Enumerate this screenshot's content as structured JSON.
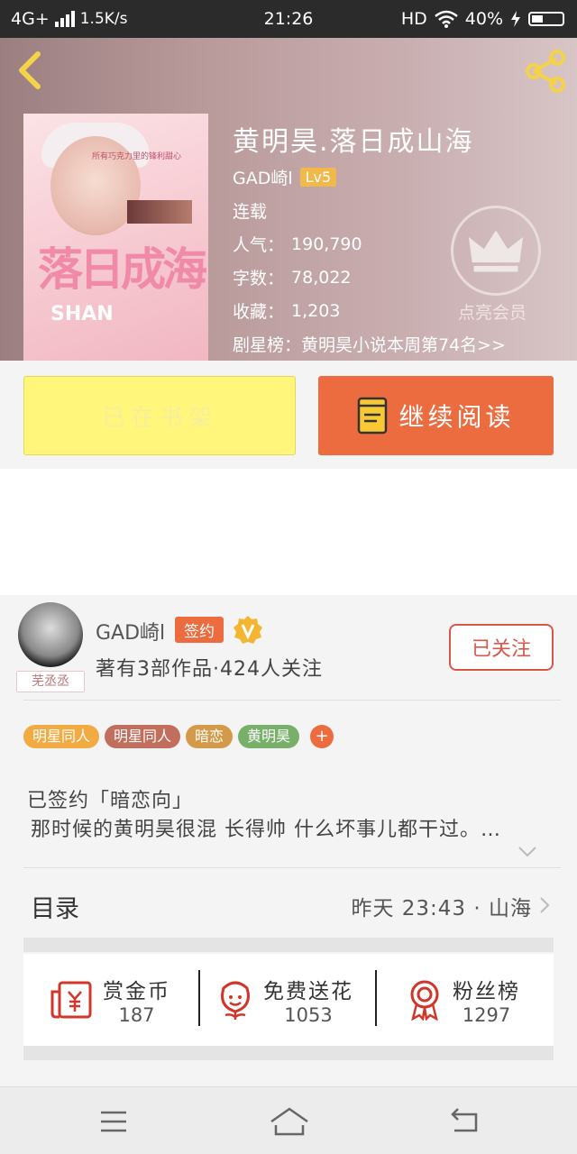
{
  "status_bar": {
    "network": "4G+",
    "speed": "1.5K/s",
    "time": "21:26",
    "hd": "HD",
    "battery": "40%"
  },
  "book": {
    "title": "黄明昊.落日成山海",
    "author": "GAD崎l",
    "level": "Lv5",
    "state": "连载",
    "popularity_label": "人气：",
    "popularity": "190,790",
    "words_label": "字数：",
    "words": "78,022",
    "favorites_label": "收藏：",
    "favorites": "1,203",
    "rank_text": "剧星榜：黄明昊小说本周第74名>>",
    "cover_title": "落日成海",
    "cover_sub": "SHAN",
    "cover_tagline": "所有巧克力里的锋利甜心"
  },
  "vip": {
    "label": "点亮会员"
  },
  "actions": {
    "shelf": "已在书架",
    "read": "继续阅读"
  },
  "author_card": {
    "name": "GAD崎l",
    "signed": "签约",
    "desc": "著有3部作品·424人关注",
    "follow": "已关注",
    "avatar_tag": "芜丞丞"
  },
  "tags": [
    {
      "label": "明星同人",
      "color": "#f2aa43"
    },
    {
      "label": "明星同人",
      "color": "#c26e5c"
    },
    {
      "label": "暗恋",
      "color": "#d49a4a"
    },
    {
      "label": "黄明昊",
      "color": "#78b06a"
    }
  ],
  "tag_more": "+",
  "description": {
    "line1": "已签约「暗恋向」",
    "line2": "那时候的黄明昊很混 长得帅 什么坏事儿都干过。…"
  },
  "toc": {
    "label": "目录",
    "latest": "昨天 23:43 · 山海"
  },
  "stats": [
    {
      "label": "赏金币",
      "value": "187"
    },
    {
      "label": "免费送花",
      "value": "1053"
    },
    {
      "label": "粉丝榜",
      "value": "1297"
    }
  ],
  "colors": {
    "accent": "#ec6b3f",
    "shelf_yellow": "#fff67b",
    "icon_red": "#d0362a"
  }
}
